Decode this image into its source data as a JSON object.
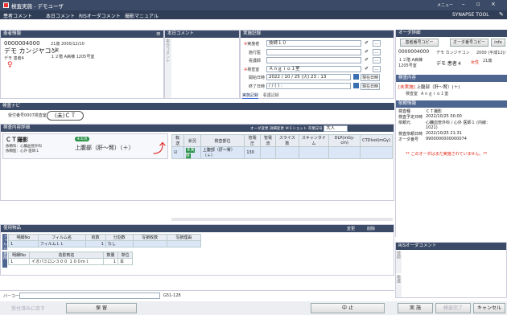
{
  "app": {
    "title": "検査実施 - デモユーザ",
    "user": "メニュー"
  },
  "menu": [
    "患者コメント",
    "本日コメント",
    "RISオーダコメント",
    "撮影マニュアル"
  ],
  "brand": "SYNAPSE TOOL",
  "patient": {
    "header": "患者情報",
    "id": "0000004000",
    "dob": "21歳 2000/12/10",
    "name_kana": "デモ カンジヤコン",
    "name_kanji": "デモ 患者4",
    "status": "入院",
    "ward": "１２階 A病棟 1205号室"
  },
  "today_comment": {
    "header": "本日コメント",
    "vertical": "本日コメント"
  },
  "exec": {
    "header": "実施記録",
    "fields": [
      {
        "label": "実施者",
        "value": "技師１０",
        "req": true
      },
      {
        "label": "施行医",
        "value": "",
        "req": false
      },
      {
        "label": "看護師",
        "value": "",
        "req": false
      },
      {
        "label": "検査室",
        "value": "Ａｎｇｉｏ１室",
        "req": true
      },
      {
        "label": "開始日時",
        "value": "2022 / 10 / 25 (火) 23 : 13",
        "req": false
      },
      {
        "label": "終了日時",
        "value": "/ / ( ) :",
        "req": false
      }
    ],
    "now_btn": "現在日時",
    "tabs": [
      "実施記録",
      "看護記録"
    ]
  },
  "order": {
    "header": "オーダ詳細",
    "copy1": "患者番号コピー",
    "copy2": "オーダ番号コピー",
    "info": "info",
    "id": "0000004000",
    "kana": "デモ カンジヤコン",
    "dob": "2000 (平成12)/",
    "ward": "１２階 A病棟 1205号室",
    "name": "デモ 患者４",
    "sex": "女性",
    "age": "21歳",
    "content_hdr": "検査内容",
    "unexec": "[未実施]",
    "content": "上腹部（肝～腎）(＋)",
    "room_label": "検査室",
    "room": "Ａｎｇｉｏ１室",
    "req_hdr": "依頼情報",
    "rows": [
      {
        "k": "検査種",
        "v": "ＣＴ撮影"
      },
      {
        "k": "検査予定日時",
        "v": "2022/10/25 00:00"
      },
      {
        "k": "依頼元",
        "v": "心臓血管外科 / 心外 医師１ (内線："
      },
      {
        "k": "",
        "v": "1021)"
      },
      {
        "k": "検査依頼日時",
        "v": "2022/10/25 21:31"
      },
      {
        "k": "オーダ番号",
        "v": "9900000000000074"
      }
    ],
    "note": "** このオーダはまだ実施されていません。**"
  },
  "nav": {
    "header": "検査ナビ",
    "receipt": "受付番号0007検査室",
    "modality": "(未)ＣＴ"
  },
  "detail": {
    "header": "検査内容詳細",
    "toolbar": [
      "オーダ変更",
      "詳細変更",
      "ＭＳショット",
      "卒業記号"
    ],
    "size": "大人",
    "type": "ＣＴ撮影",
    "dept": "依頼科：心臓血管外科",
    "doctor": "依頼医：心外 医師１",
    "badge": "未実施",
    "body": "上腹部（肝～腎）（＋）",
    "cols": [
      "転送",
      "状況",
      "検査部位",
      "管電圧",
      "管電流",
      "スライス数",
      "スキャンタイム",
      "DLP(mGy-cm)",
      "CTDIvol(mGy)"
    ],
    "row": {
      "status": "未実施",
      "part": "上腹部（肝～腎）（＋）",
      "kv": "130"
    }
  },
  "usage": {
    "header": "使用物品",
    "btn_change": "変更",
    "btn_delete": "削除",
    "film_cols": [
      "明細No",
      "フィルム名",
      "枚数",
      "分割数",
      "写損枚数",
      "写損理由"
    ],
    "film_row": {
      "no": "1",
      "name": "フィルムＬＬ",
      "count": "1",
      "split": "なし"
    },
    "drug_cols": [
      "明細No",
      "造影剤名",
      "数量",
      "単位"
    ],
    "drug_row": {
      "no": "1",
      "name": "イオパミロン３００ １００ｍｌ",
      "qty": "1",
      "unit": "本"
    },
    "side_film": "フィルム",
    "side_drug": "薬剤"
  },
  "ris_comment": {
    "header": "RISオーダコメント",
    "side1": "技師",
    "side2": "看護"
  },
  "barcode": {
    "label": "バーコード",
    "code": "G51-128"
  },
  "footer": {
    "reset": "受付済みに戻す",
    "save": "保 留",
    "stop": "中 止",
    "exec": "実 施",
    "done": "検査完了",
    "cancel": "キャンセル"
  }
}
